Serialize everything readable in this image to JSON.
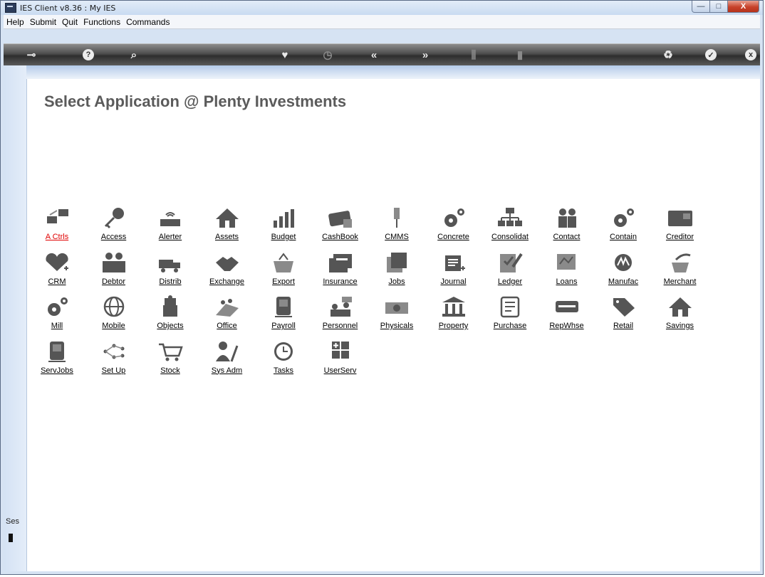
{
  "window": {
    "title": "IES Client v8.36 : My IES",
    "min_glyph": "—",
    "max_glyph": "□",
    "close_glyph": "X"
  },
  "menu": [
    "Help",
    "Submit",
    "Quit",
    "Functions",
    "Commands"
  ],
  "toolbar": {
    "buttons": [
      {
        "name": "key-icon",
        "glyph": "⊸"
      },
      {
        "name": "help-icon",
        "glyph": "?"
      },
      {
        "name": "search-icon",
        "glyph": "⌕"
      },
      {
        "name": "heart-icon",
        "glyph": "♥"
      },
      {
        "name": "clock-icon",
        "glyph": "◷"
      },
      {
        "name": "back-icon",
        "glyph": "«"
      },
      {
        "name": "forward-icon",
        "glyph": "»"
      },
      {
        "name": "columns-icon",
        "glyph": "⫼"
      },
      {
        "name": "page-icon",
        "glyph": "▮"
      },
      {
        "name": "recycle-icon",
        "glyph": "♻"
      },
      {
        "name": "check-icon",
        "glyph": "✓"
      },
      {
        "name": "close-icon",
        "glyph": "x"
      }
    ]
  },
  "page_title": "Select Application @  Plenty Investments",
  "session_label": "Ses",
  "apps": [
    {
      "label": "A Ctrls",
      "icon": "monitor-arrow-icon",
      "active": true
    },
    {
      "label": "Access",
      "icon": "key-icon"
    },
    {
      "label": "Alerter",
      "icon": "router-icon"
    },
    {
      "label": "Assets",
      "icon": "home-icon"
    },
    {
      "label": "Budget",
      "icon": "bar-chart-icon"
    },
    {
      "label": "CashBook",
      "icon": "credit-card-icon"
    },
    {
      "label": "CMMS",
      "icon": "pin-icon"
    },
    {
      "label": "Concrete",
      "icon": "gears-icon"
    },
    {
      "label": "Consolidat",
      "icon": "org-chart-icon"
    },
    {
      "label": "Contact",
      "icon": "people-icon"
    },
    {
      "label": "Contain",
      "icon": "gears-icon"
    },
    {
      "label": "Creditor",
      "icon": "card-reader-icon"
    },
    {
      "label": "CRM",
      "icon": "heart-plus-icon"
    },
    {
      "label": "Debtor",
      "icon": "group-icon"
    },
    {
      "label": "Distrib",
      "icon": "truck-icon"
    },
    {
      "label": "Exchange",
      "icon": "handshake-icon"
    },
    {
      "label": "Export",
      "icon": "basket-icon"
    },
    {
      "label": "Insurance",
      "icon": "folders-icon"
    },
    {
      "label": "Jobs",
      "icon": "documents-icon"
    },
    {
      "label": "Journal",
      "icon": "journal-icon"
    },
    {
      "label": "Ledger",
      "icon": "ledger-icon"
    },
    {
      "label": "Loans",
      "icon": "loan-icon"
    },
    {
      "label": "Manufac",
      "icon": "manufacture-icon"
    },
    {
      "label": "Merchant",
      "icon": "merchant-icon"
    },
    {
      "label": "Mill",
      "icon": "gears-icon"
    },
    {
      "label": "Mobile",
      "icon": "globe-icon"
    },
    {
      "label": "Objects",
      "icon": "puzzle-icon"
    },
    {
      "label": "Office",
      "icon": "office-icon"
    },
    {
      "label": "Payroll",
      "icon": "payroll-icon"
    },
    {
      "label": "Personnel",
      "icon": "personnel-icon"
    },
    {
      "label": "Physicals",
      "icon": "money-icon"
    },
    {
      "label": "Property",
      "icon": "bank-icon"
    },
    {
      "label": "Purchase",
      "icon": "checklist-icon"
    },
    {
      "label": "RepWhse",
      "icon": "printer-icon"
    },
    {
      "label": "Retail",
      "icon": "sale-tag-icon"
    },
    {
      "label": "Savings",
      "icon": "home-icon"
    },
    {
      "label": "ServJobs",
      "icon": "payroll-icon"
    },
    {
      "label": "Set Up",
      "icon": "network-icon"
    },
    {
      "label": "Stock",
      "icon": "cart-icon"
    },
    {
      "label": "Sys Adm",
      "icon": "admin-icon"
    },
    {
      "label": "Tasks",
      "icon": "clock-icon"
    },
    {
      "label": "UserServ",
      "icon": "calculator-icon"
    }
  ]
}
